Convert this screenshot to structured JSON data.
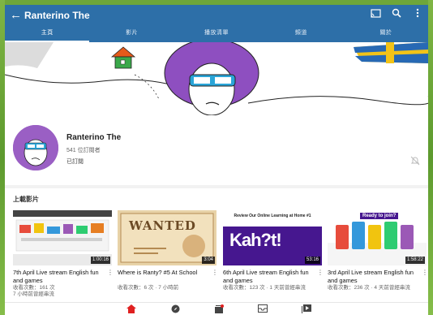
{
  "header": {
    "title": "Ranterino The",
    "back_icon": "arrow-back-icon",
    "actions": [
      "cast-icon",
      "search-icon",
      "more-vert-icon"
    ]
  },
  "tabs": [
    {
      "label": "主頁",
      "active": true
    },
    {
      "label": "影片",
      "active": false
    },
    {
      "label": "播放清單",
      "active": false
    },
    {
      "label": "頻道",
      "active": false
    },
    {
      "label": "關於",
      "active": false
    }
  ],
  "channel": {
    "name": "Ranterino The",
    "subscribers": "541 位訂閱者",
    "subscribed_label": "已訂閱"
  },
  "uploads": {
    "title": "上載影片",
    "videos": [
      {
        "title": "7th April Live stream English fun and games",
        "meta": "收看次數：161 次\n7 小時前曾經串流",
        "duration": "1:00:16"
      },
      {
        "title": "Where is Ranty? #5 At School",
        "meta": "收看次數：6 次 · 7 小時前",
        "duration": "3:04"
      },
      {
        "title": "6th April Live stream English fun and games",
        "meta": "收看次數：123 次 · 1 天前曾經串流",
        "duration": "53:16"
      },
      {
        "title": "3rd April Live stream English fun and games",
        "meta": "收看次數：236 次 · 4 天前曾經串流",
        "duration": "1:58:22"
      }
    ]
  },
  "thumb_text": {
    "wanted": "WANTED",
    "review": "Review Our Online Learning at Home #1",
    "kahoot": "Kah?t!",
    "ready": "Ready to join?"
  },
  "colors": {
    "app_bar": "#2d6fa8",
    "frame": "#6ea63a",
    "active_nav": "#e02020"
  },
  "bottom_nav": [
    {
      "icon": "home-icon",
      "active": true
    },
    {
      "icon": "explore-icon",
      "active": false
    },
    {
      "icon": "subscriptions-icon",
      "active": false
    },
    {
      "icon": "inbox-icon",
      "active": false
    },
    {
      "icon": "library-icon",
      "active": false
    }
  ]
}
